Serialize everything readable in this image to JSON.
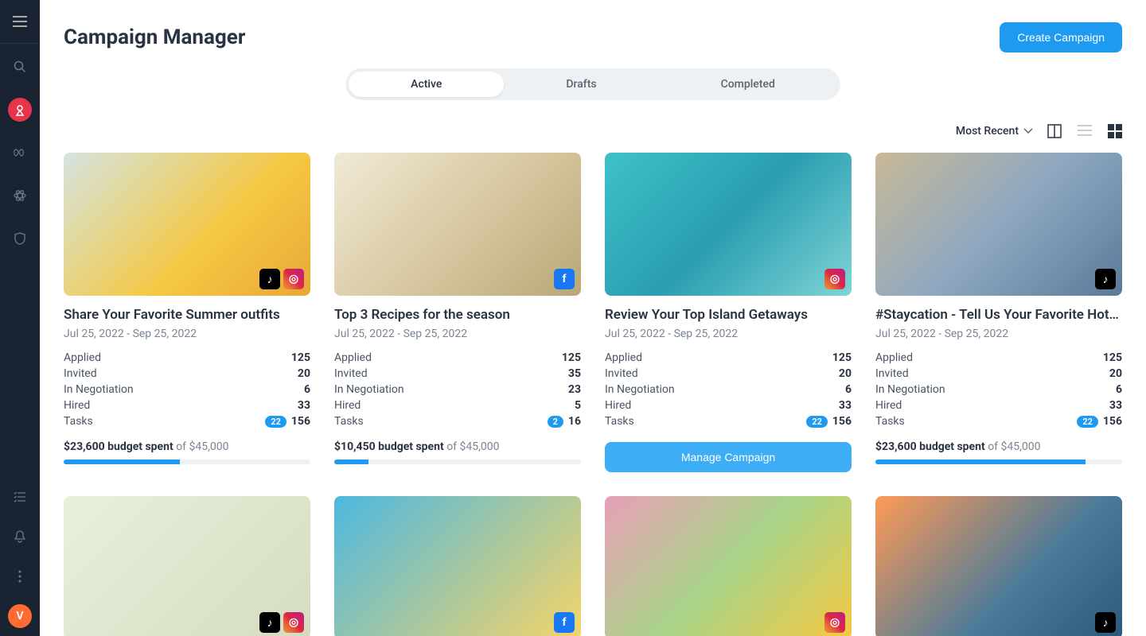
{
  "page": {
    "title": "Campaign Manager",
    "create_label": "Create Campaign"
  },
  "tabs": {
    "active": "Active",
    "drafts": "Drafts",
    "completed": "Completed"
  },
  "sort": {
    "label": "Most Recent"
  },
  "avatar": {
    "initial": "V"
  },
  "stat_labels": {
    "applied": "Applied",
    "invited": "Invited",
    "negotiation": "In Negotiation",
    "hired": "Hired",
    "tasks": "Tasks"
  },
  "budget": {
    "spent_suffix": "budget spent",
    "of_word": "of"
  },
  "manage_label": "Manage Campaign",
  "campaigns": [
    {
      "title": "Share Your Favorite Summer outfits",
      "date": "Jul 25, 2022 - Sep 25, 2022",
      "applied": "125",
      "invited": "20",
      "negotiation": "6",
      "hired": "33",
      "task_badge": "22",
      "tasks": "156",
      "spent": "$23,600",
      "total": "$45,000",
      "progress_pct": 47,
      "platforms": [
        "tt",
        "ig"
      ],
      "img": "img1"
    },
    {
      "title": "Top 3 Recipes for the season",
      "date": "Jul 25, 2022 - Sep 25, 2022",
      "applied": "125",
      "invited": "35",
      "negotiation": "23",
      "hired": "5",
      "task_badge": "2",
      "tasks": "16",
      "spent": "$10,450",
      "total": "$45,000",
      "progress_pct": 14,
      "platforms": [
        "fb"
      ],
      "img": "img2"
    },
    {
      "title": "Review Your Top Island Getaways",
      "date": "Jul 25, 2022 - Sep 25, 2022",
      "applied": "125",
      "invited": "20",
      "negotiation": "6",
      "hired": "33",
      "task_badge": "22",
      "tasks": "156",
      "manage": true,
      "platforms": [
        "ig"
      ],
      "img": "img3"
    },
    {
      "title": "#Staycation - Tell Us Your Favorite Hot…",
      "date": "Jul 25, 2022 - Sep 25, 2022",
      "applied": "125",
      "invited": "20",
      "negotiation": "6",
      "hired": "33",
      "task_badge": "22",
      "tasks": "156",
      "spent": "$23,600",
      "total": "$45,000",
      "progress_pct": 85,
      "platforms": [
        "tt"
      ],
      "img": "img4"
    },
    {
      "platforms": [
        "tt",
        "ig"
      ],
      "img": "img5",
      "partial": true
    },
    {
      "platforms": [
        "fb"
      ],
      "img": "img6",
      "partial": true
    },
    {
      "platforms": [
        "ig"
      ],
      "img": "img7",
      "partial": true
    },
    {
      "platforms": [
        "tt"
      ],
      "img": "img8",
      "partial": true
    }
  ]
}
